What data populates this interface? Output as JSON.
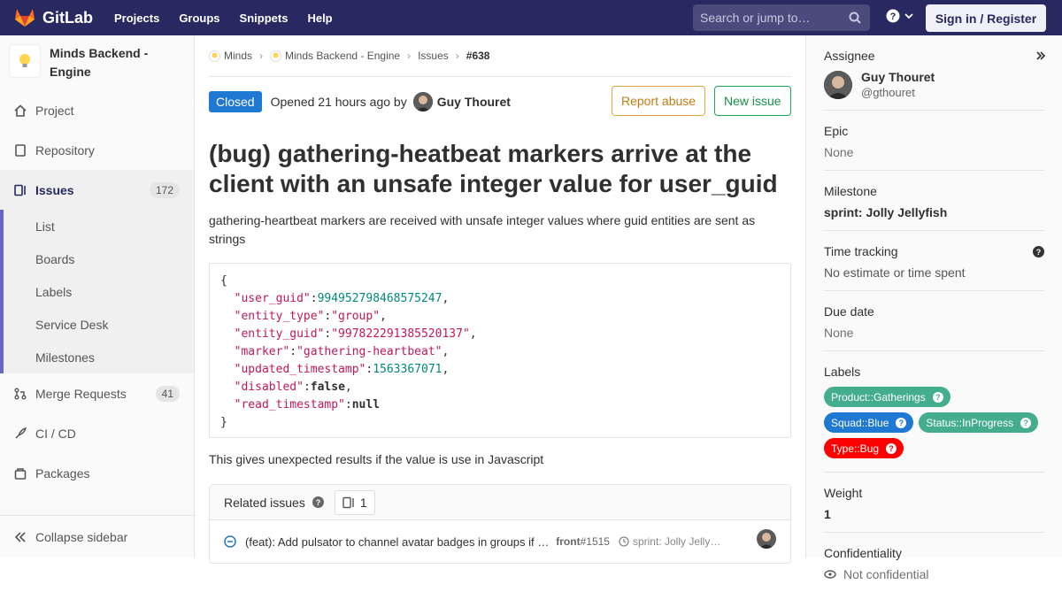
{
  "topbar": {
    "brand": "GitLab",
    "nav": [
      "Projects",
      "Groups",
      "Snippets",
      "Help"
    ],
    "search_placeholder": "Search or jump to…",
    "signin": "Sign in / Register"
  },
  "sidebar": {
    "project_name": "Minds Backend - Engine",
    "items": [
      {
        "label": "Project",
        "icon": "home-icon"
      },
      {
        "label": "Repository",
        "icon": "doc-icon"
      },
      {
        "label": "Issues",
        "icon": "issues-icon",
        "count": "172"
      },
      {
        "label": "Merge Requests",
        "icon": "merge-icon",
        "count": "41"
      },
      {
        "label": "CI / CD",
        "icon": "rocket-icon"
      },
      {
        "label": "Packages",
        "icon": "package-icon"
      }
    ],
    "issues_sub": [
      "List",
      "Boards",
      "Labels",
      "Service Desk",
      "Milestones"
    ],
    "collapse": "Collapse sidebar"
  },
  "breadcrumb": [
    "Minds",
    "Minds Backend - Engine",
    "Issues",
    "#638"
  ],
  "issue": {
    "status": "Closed",
    "opened": "Opened 21 hours ago by",
    "author": "Guy Thouret",
    "report_abuse": "Report abuse",
    "new_issue": "New issue",
    "title": "(bug) gathering-heatbeat markers arrive at the client with an unsafe integer value for user_guid",
    "description": "gathering-heartbeat markers are received with unsafe integer values where guid entities are sent as strings",
    "code": {
      "user_guid": "994952798468575247",
      "entity_type": "\"group\"",
      "entity_guid": "\"997822291385520137\"",
      "marker": "\"gathering-heartbeat\"",
      "updated_timestamp": "1563367071",
      "disabled": "false",
      "read_timestamp": "null"
    },
    "after": "This gives unexpected results if the value is use in Javascript"
  },
  "related": {
    "title": "Related issues",
    "count": "1",
    "row": {
      "text": "(feat): Add pulsator to channel avatar badges in groups if …",
      "ref_proj": "front",
      "ref_num": "#1515",
      "milestone": "sprint: Jolly Jelly…"
    }
  },
  "right": {
    "assignee_title": "Assignee",
    "assignee_name": "Guy Thouret",
    "assignee_handle": "@gthouret",
    "epic_title": "Epic",
    "epic": "None",
    "milestone_title": "Milestone",
    "milestone": "sprint: Jolly Jellyfish",
    "time_title": "Time tracking",
    "time": "No estimate or time spent",
    "due_title": "Due date",
    "due": "None",
    "labels_title": "Labels",
    "labels": [
      {
        "name": "Product::Gatherings",
        "color": "#44ad8e"
      },
      {
        "name": "Squad::Blue",
        "color": "#1f78d1"
      },
      {
        "name": "Status::InProgress",
        "color": "#44ad8e"
      },
      {
        "name": "Type::Bug",
        "color": "#ff0000"
      }
    ],
    "weight_title": "Weight",
    "weight": "1",
    "conf_title": "Confidentiality",
    "conf": "Not confidential"
  }
}
